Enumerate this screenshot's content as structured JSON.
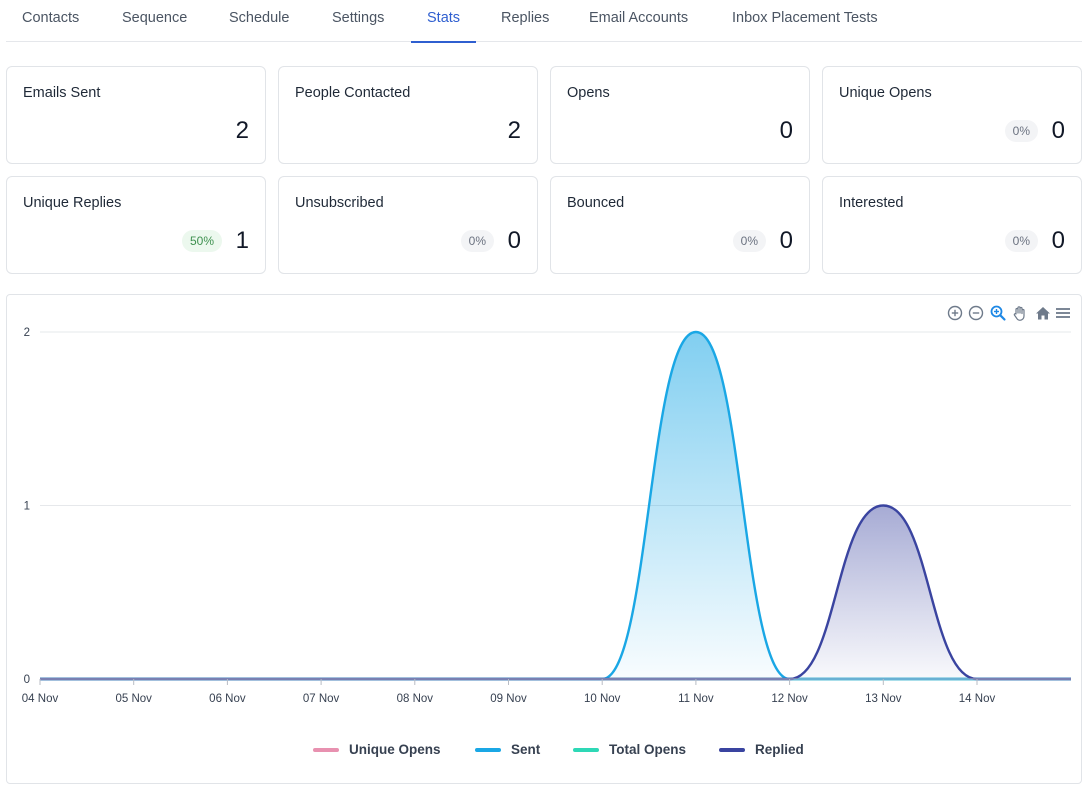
{
  "tabs": [
    {
      "label": "Contacts",
      "active": false
    },
    {
      "label": "Sequence",
      "active": false
    },
    {
      "label": "Schedule",
      "active": false
    },
    {
      "label": "Settings",
      "active": false
    },
    {
      "label": "Stats",
      "active": true
    },
    {
      "label": "Replies",
      "active": false
    },
    {
      "label": "Email Accounts",
      "active": false
    },
    {
      "label": "Inbox Placement Tests",
      "active": false
    }
  ],
  "stats": [
    {
      "label": "Emails Sent",
      "value": "2",
      "pct": null
    },
    {
      "label": "People Contacted",
      "value": "2",
      "pct": null
    },
    {
      "label": "Opens",
      "value": "0",
      "pct": null
    },
    {
      "label": "Unique Opens",
      "value": "0",
      "pct": "0%"
    },
    {
      "label": "Unique Replies",
      "value": "1",
      "pct": "50%"
    },
    {
      "label": "Unsubscribed",
      "value": "0",
      "pct": "0%"
    },
    {
      "label": "Bounced",
      "value": "0",
      "pct": "0%"
    },
    {
      "label": "Interested",
      "value": "0",
      "pct": "0%"
    }
  ],
  "toolbar": {
    "icons": [
      "zoom-in-icon",
      "zoom-out-icon",
      "selection-zoom-icon",
      "pan-icon",
      "reset-home-icon",
      "menu-icon"
    ]
  },
  "colors": {
    "accent": "#2f5fd0",
    "unique_opens": "#e891b0",
    "sent": "#1aa7e5",
    "total_opens": "#2ed8b6",
    "replied": "#3a44a0",
    "positive_badge_bg": "#ecf8ee",
    "positive_badge_text": "#3f9150"
  },
  "chart_data": {
    "type": "area",
    "categories": [
      "04 Nov",
      "05 Nov",
      "06 Nov",
      "07 Nov",
      "08 Nov",
      "09 Nov",
      "10 Nov",
      "11 Nov",
      "12 Nov",
      "13 Nov",
      "14 Nov"
    ],
    "ylim": [
      0,
      2
    ],
    "yticks": [
      "0",
      "1",
      "2"
    ],
    "grid": true,
    "legend_position": "bottom",
    "series": [
      {
        "name": "Unique Opens",
        "values": [
          0,
          0,
          0,
          0,
          0,
          0,
          0,
          0,
          0,
          0,
          0
        ],
        "color": "#e891b0"
      },
      {
        "name": "Sent",
        "values": [
          0,
          0,
          0,
          0,
          0,
          0,
          0,
          2,
          0,
          0,
          0
        ],
        "color": "#1aa7e5"
      },
      {
        "name": "Total Opens",
        "values": [
          0,
          0,
          0,
          0,
          0,
          0,
          0,
          0,
          0,
          0,
          0
        ],
        "color": "#2ed8b6"
      },
      {
        "name": "Replied",
        "values": [
          0,
          0,
          0,
          0,
          0,
          0,
          0,
          0,
          0,
          1,
          0
        ],
        "color": "#3a44a0"
      }
    ]
  }
}
